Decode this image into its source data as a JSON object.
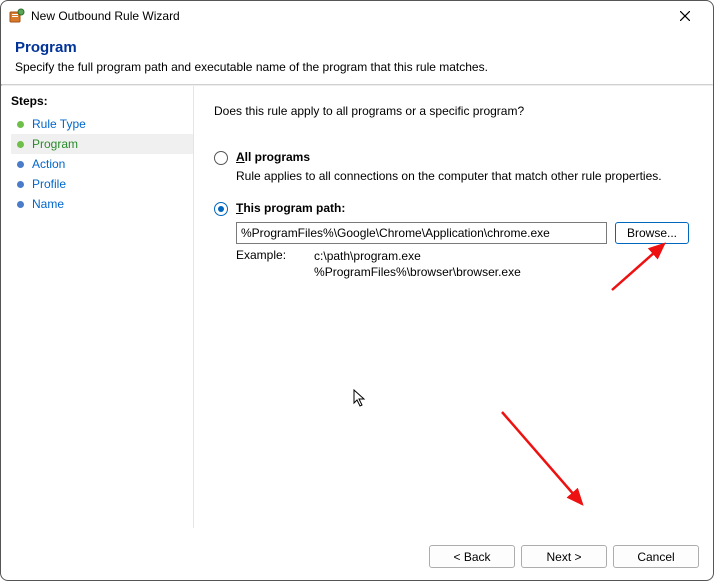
{
  "window": {
    "title": "New Outbound Rule Wizard"
  },
  "header": {
    "heading": "Program",
    "description": "Specify the full program path and executable name of the program that this rule matches."
  },
  "sidebar": {
    "title": "Steps:",
    "items": [
      {
        "label": "Rule Type",
        "state": "link"
      },
      {
        "label": "Program",
        "state": "current"
      },
      {
        "label": "Action",
        "state": "future"
      },
      {
        "label": "Profile",
        "state": "future"
      },
      {
        "label": "Name",
        "state": "future"
      }
    ]
  },
  "content": {
    "question": "Does this rule apply to all programs or a specific program?",
    "option_all": {
      "label_prefix": "A",
      "label_rest": "ll programs",
      "desc": "Rule applies to all connections on the computer that match other rule properties.",
      "selected": false
    },
    "option_path": {
      "label_prefix": "T",
      "label_rest": "his program path:",
      "selected": true,
      "value": "%ProgramFiles%\\Google\\Chrome\\Application\\chrome.exe",
      "browse_label": "Browse...",
      "example_label": "Example:",
      "example_line1": "c:\\path\\program.exe",
      "example_line2": "%ProgramFiles%\\browser\\browser.exe"
    }
  },
  "footer": {
    "back": "< Back",
    "next": "Next >",
    "cancel": "Cancel"
  }
}
